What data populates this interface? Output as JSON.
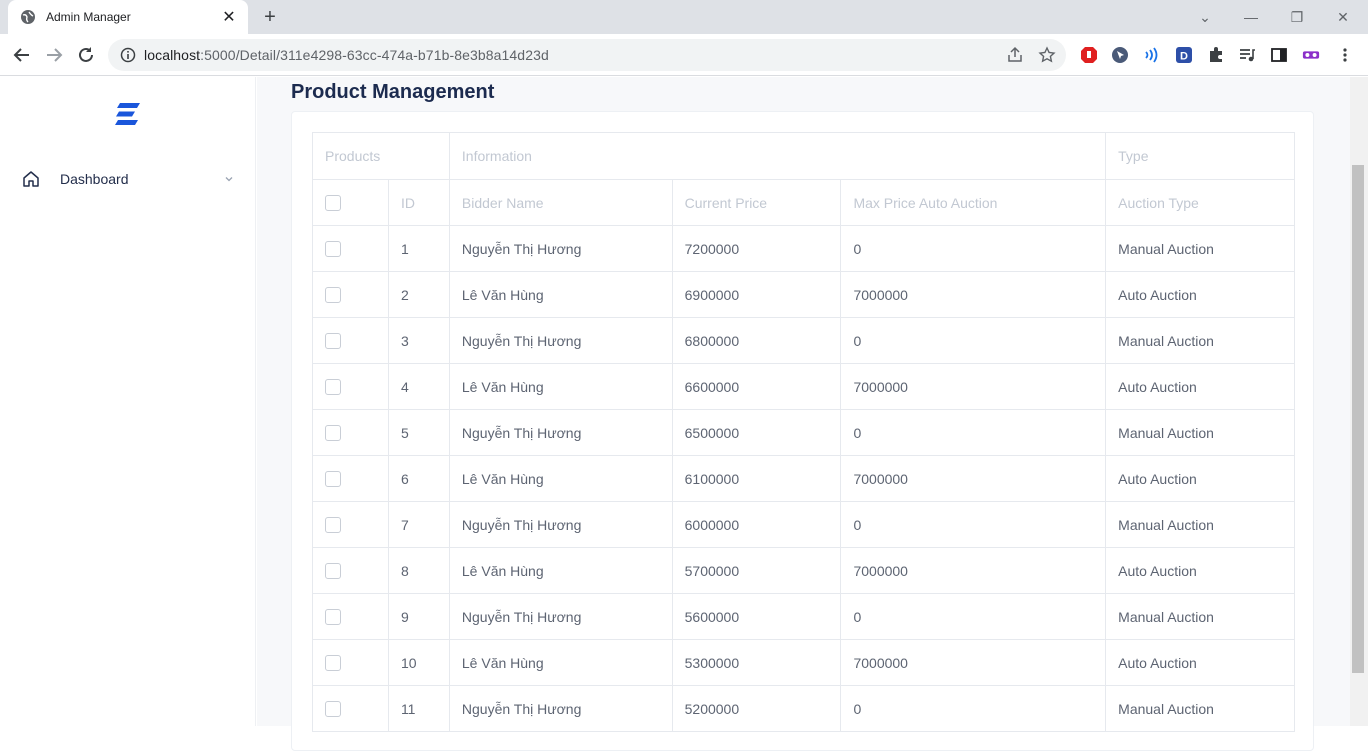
{
  "browser": {
    "tab_title": "Admin Manager",
    "url_host": "localhost",
    "url_rest": ":5000/Detail/311e4298-63cc-474a-b71b-8e3b8a14d23d"
  },
  "sidebar": {
    "items": [
      {
        "label": "Dashboard",
        "icon": "home-icon"
      }
    ]
  },
  "page": {
    "title": "Product Management"
  },
  "table": {
    "group_headers": [
      "Products",
      "Information",
      "Type"
    ],
    "columns": [
      "",
      "ID",
      "Bidder Name",
      "Current Price",
      "Max Price Auto Auction",
      "Auction Type"
    ],
    "rows": [
      {
        "id": "1",
        "bidder": "Nguyễn Thị Hương",
        "current": "7200000",
        "max": "0",
        "type": "Manual Auction"
      },
      {
        "id": "2",
        "bidder": "Lê Văn Hùng",
        "current": "6900000",
        "max": "7000000",
        "type": "Auto Auction"
      },
      {
        "id": "3",
        "bidder": "Nguyễn Thị Hương",
        "current": "6800000",
        "max": "0",
        "type": "Manual Auction"
      },
      {
        "id": "4",
        "bidder": "Lê Văn Hùng",
        "current": "6600000",
        "max": "7000000",
        "type": "Auto Auction"
      },
      {
        "id": "5",
        "bidder": "Nguyễn Thị Hương",
        "current": "6500000",
        "max": "0",
        "type": "Manual Auction"
      },
      {
        "id": "6",
        "bidder": "Lê Văn Hùng",
        "current": "6100000",
        "max": "7000000",
        "type": "Auto Auction"
      },
      {
        "id": "7",
        "bidder": "Nguyễn Thị Hương",
        "current": "6000000",
        "max": "0",
        "type": "Manual Auction"
      },
      {
        "id": "8",
        "bidder": "Lê Văn Hùng",
        "current": "5700000",
        "max": "7000000",
        "type": "Auto Auction"
      },
      {
        "id": "9",
        "bidder": "Nguyễn Thị Hương",
        "current": "5600000",
        "max": "0",
        "type": "Manual Auction"
      },
      {
        "id": "10",
        "bidder": "Lê Văn Hùng",
        "current": "5300000",
        "max": "7000000",
        "type": "Auto Auction"
      },
      {
        "id": "11",
        "bidder": "Nguyễn Thị Hương",
        "current": "5200000",
        "max": "0",
        "type": "Manual Auction"
      }
    ]
  },
  "colors": {
    "accent": "#1a56db",
    "title": "#1c2b4f"
  }
}
